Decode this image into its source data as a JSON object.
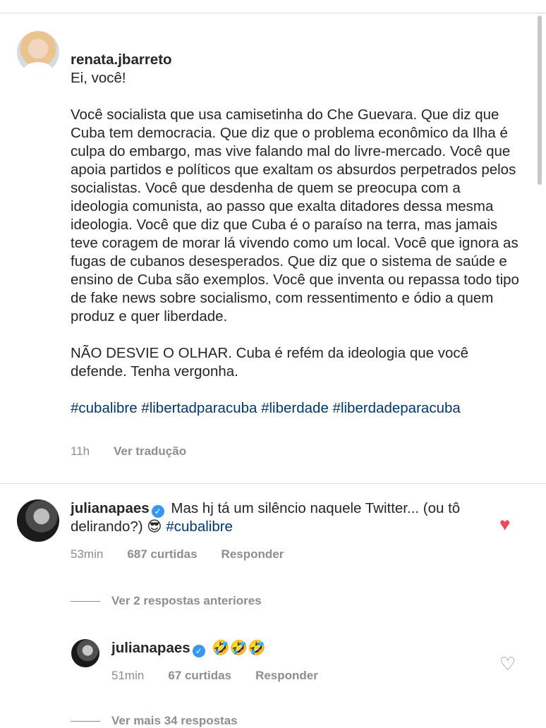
{
  "post": {
    "username": "renata.jbarreto",
    "greeting": "Ei, você!",
    "paragraph1": "Você socialista que usa camisetinha do Che Guevara. Que diz que Cuba tem democracia. Que diz que o problema econômico da Ilha é culpa do embargo, mas vive falando mal do livre-mercado. Você que apoia partidos e políticos que exaltam os absurdos perpetrados pelos socialistas. Você que desdenha de quem se preocupa com a ideologia comunista, ao passo que exalta ditadores dessa mesma ideologia. Você que diz que Cuba é o paraíso na terra, mas jamais teve coragem de morar lá vivendo como um local. Você que ignora as fugas de cubanos desesperados. Que diz que o sistema de saúde e ensino de Cuba são exemplos. Você que inventa ou repassa todo tipo de fake news sobre socialismo, com ressentimento e ódio a quem produz e quer liberdade.",
    "paragraph2": "NÃO DESVIE O OLHAR. Cuba é refém da ideologia que você defende. Tenha vergonha.",
    "hashtags": "#cubalibre #libertadparacuba #liberdade #liberdadeparacuba",
    "time": "11h",
    "translate_label": "Ver tradução"
  },
  "reply1": {
    "username": "julianapaes",
    "verified_mark": "✓",
    "text": "Mas hj tá um silêncio naquele Twitter... (ou tô delirando?)",
    "emoji": "😎",
    "hashtag": "#cubalibre",
    "time": "53min",
    "likes": "687 curtidas",
    "reply_label": "Responder",
    "liked": true,
    "heart_icon": "♥"
  },
  "view_previous": "Ver 2 respostas anteriores",
  "reply2": {
    "username": "julianapaes",
    "verified_mark": "✓",
    "emojis": "🤣🤣🤣",
    "time": "51min",
    "likes": "67 curtidas",
    "reply_label": "Responder",
    "heart_icon": "♡"
  },
  "view_more": "Ver mais 34 respostas",
  "colors": {
    "text": "#262626",
    "muted": "#8e8e8e",
    "link": "#00376b",
    "heart": "#ed4956",
    "verified": "#3897f0"
  }
}
